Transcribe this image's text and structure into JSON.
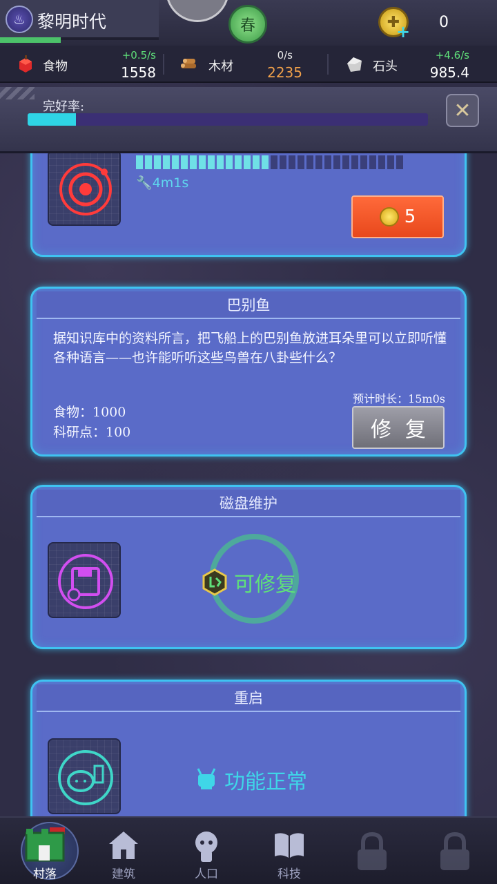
{
  "header": {
    "title": "黎明时代",
    "season": "春",
    "coins": "0"
  },
  "resources": [
    {
      "name": "食物",
      "rate": "+0.5/s",
      "amount": "1558",
      "rate_color": "#5fe07a",
      "amount_color": "#ffffff"
    },
    {
      "name": "木材",
      "rate": "0/s",
      "amount": "2235",
      "rate_color": "#e8e8e8",
      "amount_color": "#f0a04a"
    },
    {
      "name": "石头",
      "rate": "+4.6/s",
      "amount": "985.4",
      "rate_color": "#5fe07a",
      "amount_color": "#ffffff"
    }
  ],
  "integrity": {
    "label": "完好率:",
    "fill_fraction": 0.12
  },
  "cards": {
    "speaker": {
      "timer": "4m1s",
      "cost": "5",
      "segments_on": 15,
      "segments_total": 48
    },
    "babel": {
      "title": "巴别鱼",
      "description": "据知识库中的资料所言，把飞船上的巴别鱼放进耳朵里可以立即听懂各种语言——也许能听听这些鸟兽在八卦些什么？",
      "cost_food": "食物：1000",
      "cost_research": "科研点：100",
      "eta": "预计时长：15m0s",
      "button": "修复"
    },
    "disk": {
      "title": "磁盘维护",
      "status": "可修复",
      "status_color": "#5fe07a"
    },
    "reboot": {
      "title": "重启",
      "status": "功能正常",
      "status_color": "#3fd6e8"
    }
  },
  "nav": [
    {
      "label": "村落",
      "icon": "village-icon",
      "active": true
    },
    {
      "label": "建筑",
      "icon": "house-icon",
      "active": false
    },
    {
      "label": "人口",
      "icon": "person-icon",
      "active": false
    },
    {
      "label": "科技",
      "icon": "book-icon",
      "active": false
    }
  ]
}
